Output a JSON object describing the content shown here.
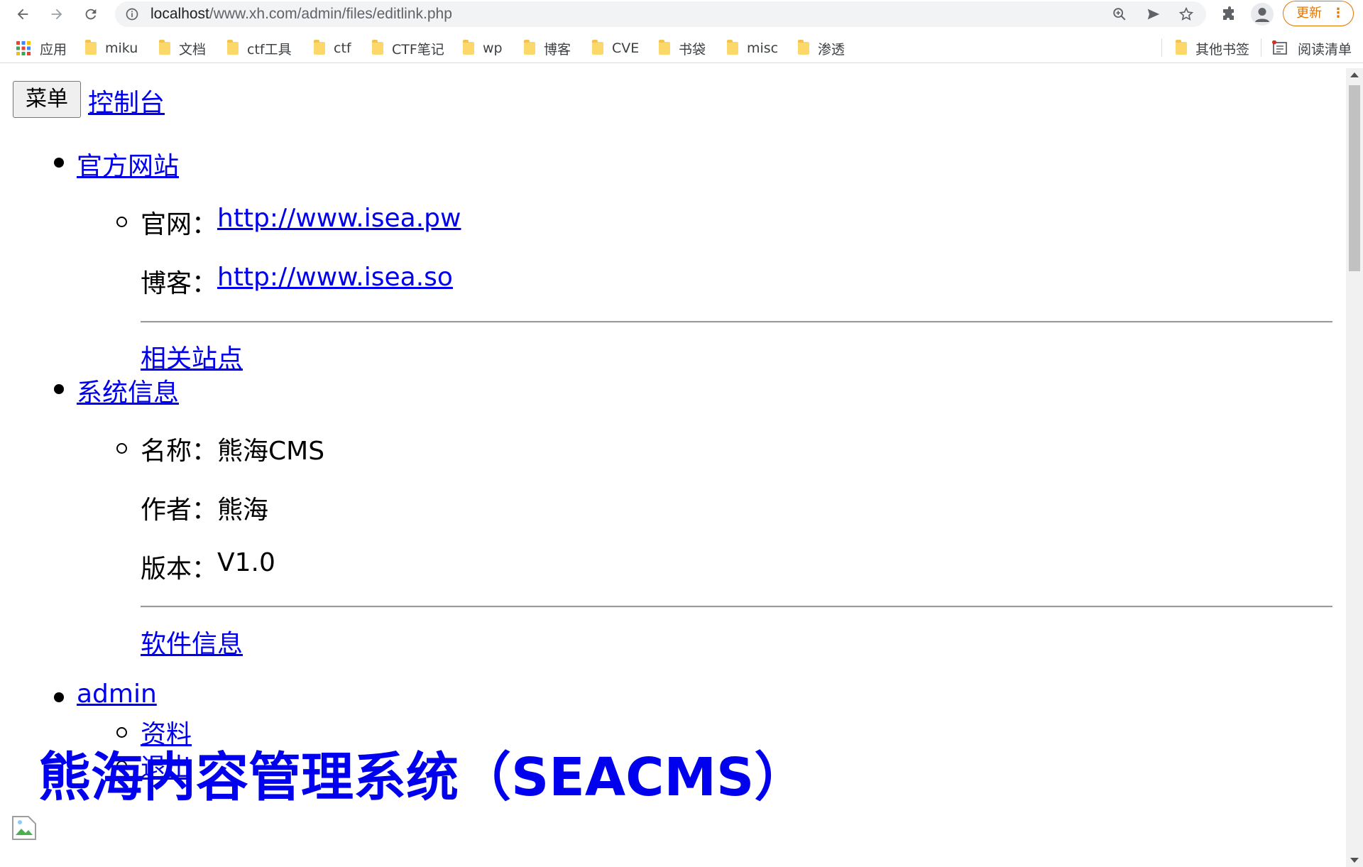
{
  "browser": {
    "url_host": "localhost",
    "url_path": "/www.xh.com/admin/files/editlink.php",
    "update_label": "更新",
    "icons": [
      "back-icon",
      "forward-icon",
      "reload-icon",
      "info-icon",
      "zoom-icon",
      "send-icon",
      "star-icon",
      "extensions-icon",
      "profile-icon",
      "more-icon"
    ]
  },
  "bookmarks": {
    "apps": "应用",
    "items": [
      "miku",
      "文档",
      "ctf工具",
      "ctf",
      "CTF笔记",
      "wp",
      "博客",
      "CVE",
      "书袋",
      "misc",
      "渗透"
    ],
    "other": "其他书签",
    "reading_list": "阅读清单"
  },
  "page": {
    "menu_button": "菜单",
    "console_link": "控制台",
    "nav": {
      "official": {
        "title": "官方网站",
        "site_label": "官网：",
        "site_url": "http://www.isea.pw",
        "blog_label": "博客：",
        "blog_url": "http://www.isea.so",
        "related": "相关站点"
      },
      "sysinfo": {
        "title": "系统信息",
        "name_label": "名称：",
        "name_value": "熊海CMS",
        "author_label": "作者：",
        "author_value": "熊海",
        "version_label": "版本：",
        "version_value": "V1.0",
        "software": "软件信息"
      },
      "admin": {
        "title": "admin",
        "profile": "资料",
        "logout": "退出"
      }
    },
    "heading": "熊海内容管理系统（SEACMS）"
  },
  "colors": {
    "link": "#0000ee",
    "update_accent": "#e37400",
    "omnibox_bg": "#f1f3f4"
  }
}
